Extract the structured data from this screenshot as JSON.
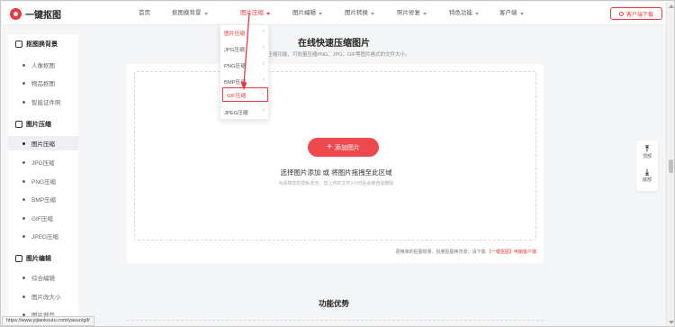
{
  "header": {
    "logo_text": "一键抠图",
    "nav": [
      {
        "label": "首页",
        "has_caret": false
      },
      {
        "label": "抠图换背景",
        "has_caret": true
      },
      {
        "label": "图片压缩",
        "has_caret": true,
        "active": true
      },
      {
        "label": "图片编辑",
        "has_caret": true
      },
      {
        "label": "图片转换",
        "has_caret": true
      },
      {
        "label": "照片修复",
        "has_caret": true
      },
      {
        "label": "特色功能",
        "has_caret": true
      },
      {
        "label": "客户端",
        "has_caret": true
      }
    ],
    "download_button": "客户端下载"
  },
  "dropdown": {
    "items": [
      {
        "label": "图片压缩",
        "state": "active"
      },
      {
        "label": "JPG压缩",
        "state": ""
      },
      {
        "label": "PNG压缩",
        "state": ""
      },
      {
        "label": "BMP压缩",
        "state": ""
      },
      {
        "label": "GIF压缩",
        "state": "highlight"
      },
      {
        "label": "JPEG压缩",
        "state": ""
      }
    ]
  },
  "sidebar": {
    "groups": [
      {
        "title": "抠图换背景",
        "items": [
          "人像抠图",
          "物品抠图",
          "智能证件照"
        ]
      },
      {
        "title": "图片压缩",
        "items": [
          "图片压缩",
          "JPG压缩",
          "PNG压缩",
          "BMP压缩",
          "GIF压缩",
          "JPEG压缩"
        ]
      },
      {
        "title": "图片编辑",
        "items": [
          "综合编辑",
          "图片改大小",
          "图片裁剪"
        ]
      }
    ],
    "active_item": "图片压缩"
  },
  "main": {
    "title": "在线快速压缩图片",
    "subtitle": "图片压缩功能，可批量压缩PNG、JPG、GIF等图片格式的文件大小。",
    "add_button": "添加图片",
    "drop_text": "选择图片添加 或 将图片拖拽至此区域",
    "drop_note": "为保障您的隐私安全，您上传的文件1小时后会被自动删除",
    "footer_note_prefix": "更精准的抠图效果、批量抠图换背景，请下载",
    "footer_note_link": "【一键抠图】电脑客户端",
    "section_title": "功能优势"
  },
  "float": {
    "top_label": "顶部",
    "bottom_label": "底部"
  },
  "status_bar": {
    "url": "https://www.yijiankoutu.com/yasuo/gif/"
  },
  "colors": {
    "accent": "#e8383d",
    "button": "#ee4a4e",
    "background": "#f4f5f7"
  }
}
